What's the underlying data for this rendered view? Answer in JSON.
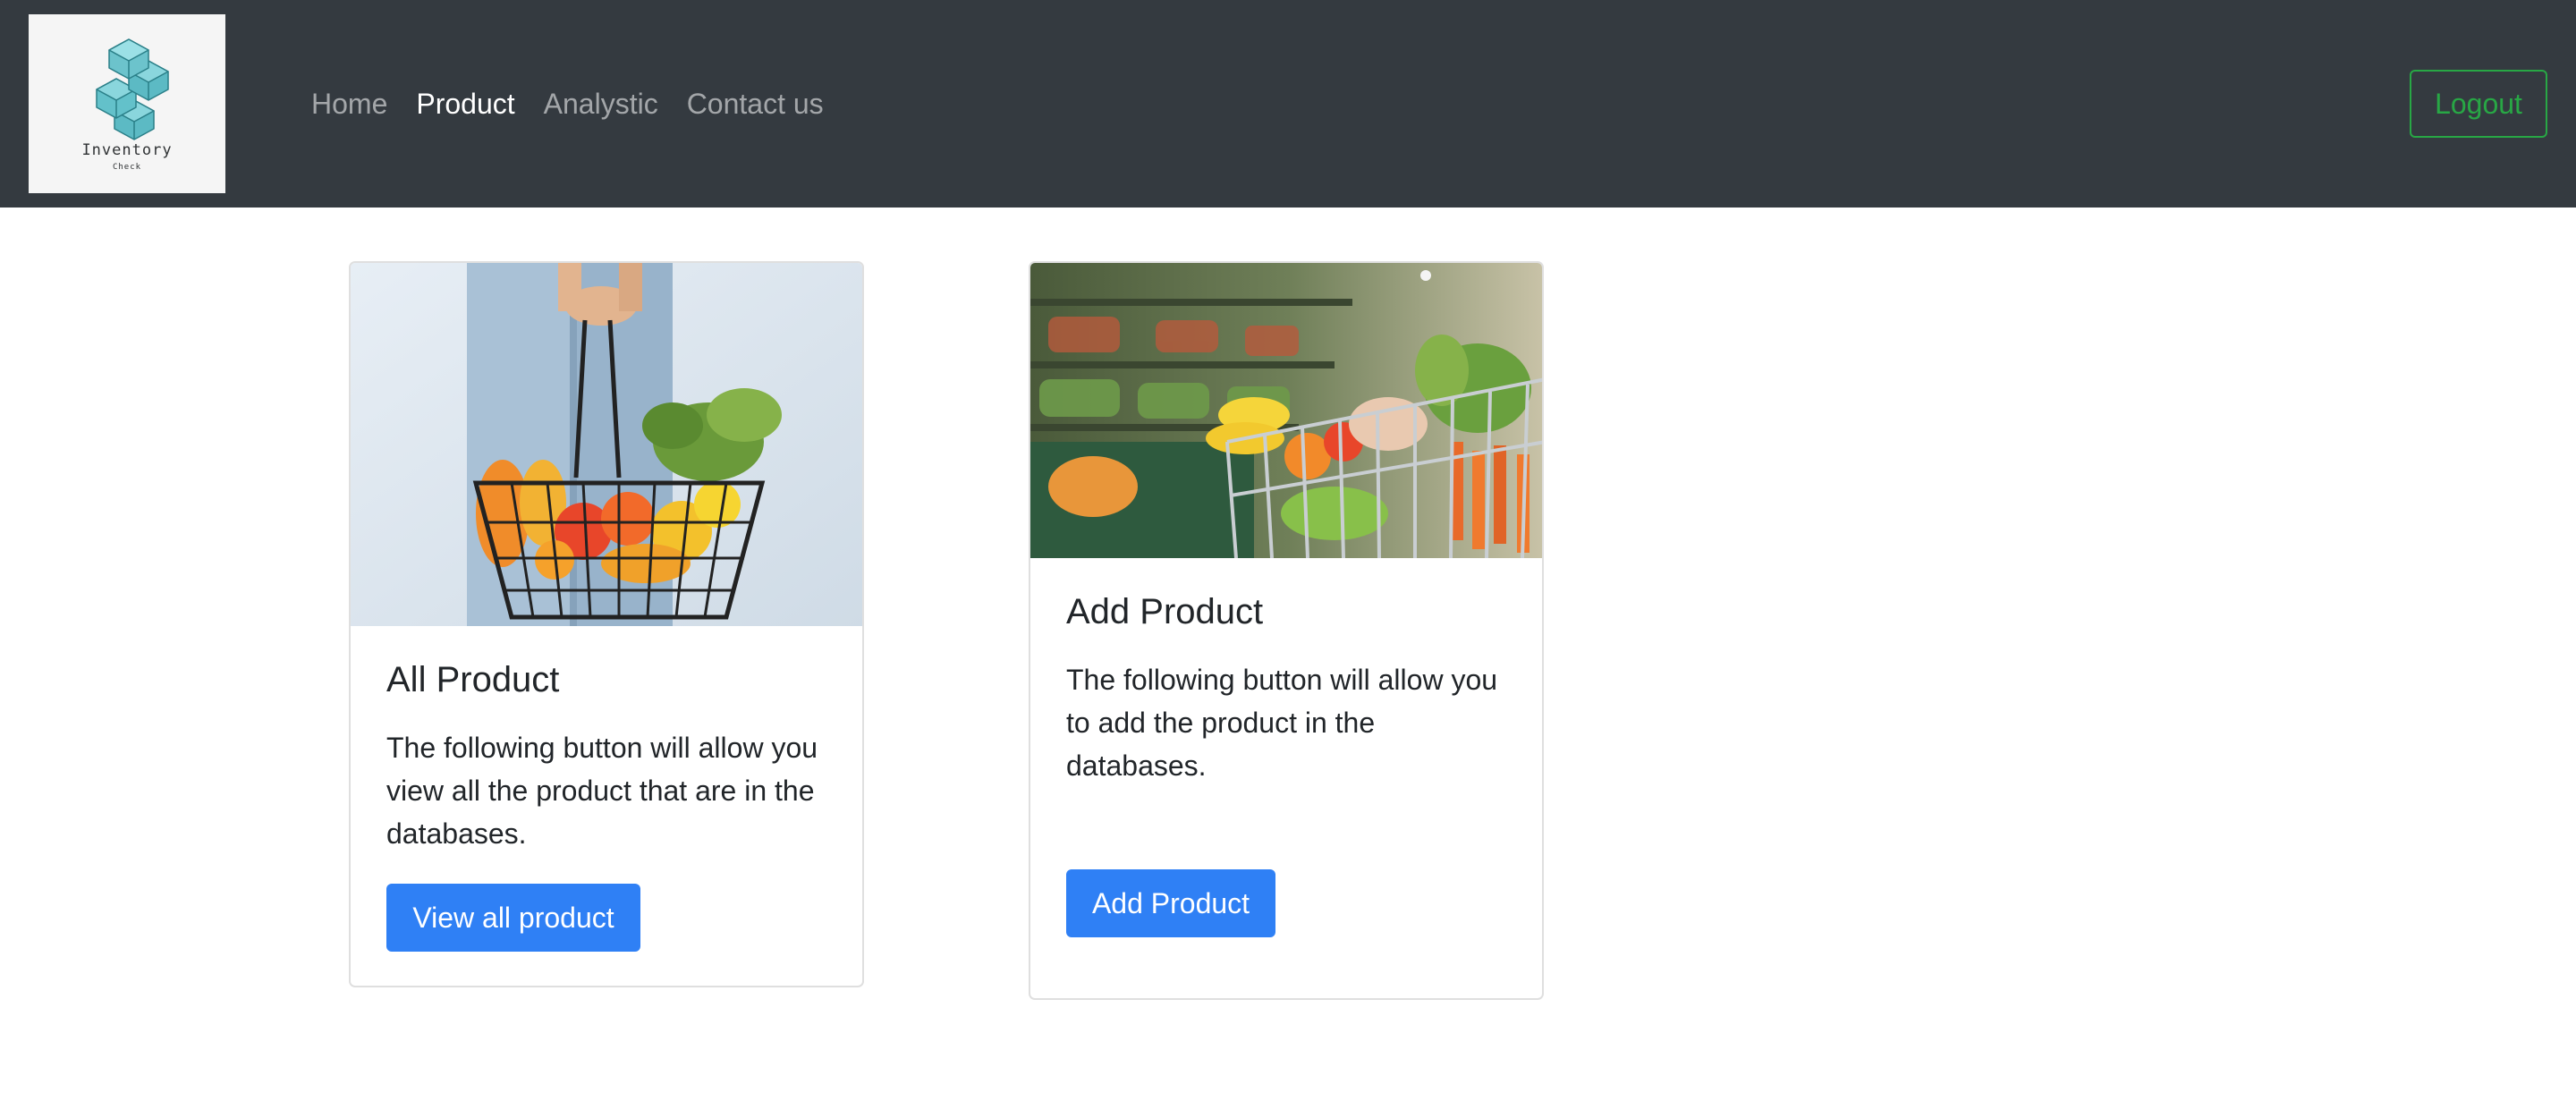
{
  "brand": {
    "word": "Inventory",
    "sub": "Check",
    "logo_color": "#6cc3cc"
  },
  "nav": {
    "items": [
      {
        "label": "Home",
        "active": false
      },
      {
        "label": "Product",
        "active": true
      },
      {
        "label": "Analystic",
        "active": false
      },
      {
        "label": "Contact us",
        "active": false
      }
    ],
    "logout_label": "Logout"
  },
  "cards": [
    {
      "image": "grocery-basket-image",
      "title": "All Product",
      "text": "The following button will allow you view all the product that are in the databases.",
      "button_label": "View all product"
    },
    {
      "image": "shopping-cart-image",
      "title": "Add Product",
      "text": "The following button will allow you to add the product in the databases.",
      "button_label": "Add Product"
    }
  ],
  "colors": {
    "navbar": "#343a40",
    "primary": "#2f80f5",
    "success": "#28a745"
  }
}
